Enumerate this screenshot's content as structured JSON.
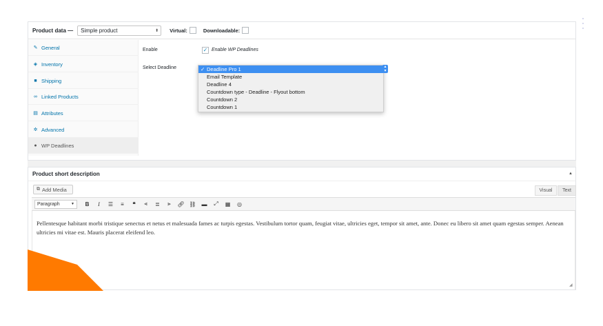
{
  "product_data": {
    "title": "Product data —",
    "type_select": "Simple product",
    "virtual_label": "Virtual:",
    "downloadable_label": "Downloadable:"
  },
  "tabs": [
    {
      "label": "General",
      "icon": "wrench-icon",
      "active": false
    },
    {
      "label": "Inventory",
      "icon": "tag-icon",
      "active": false
    },
    {
      "label": "Shipping",
      "icon": "truck-icon",
      "active": false
    },
    {
      "label": "Linked Products",
      "icon": "link-icon",
      "active": false
    },
    {
      "label": "Attributes",
      "icon": "table-icon",
      "active": false
    },
    {
      "label": "Advanced",
      "icon": "gear-icon",
      "active": false
    },
    {
      "label": "WP Deadlines",
      "icon": "clock-icon",
      "active": true
    }
  ],
  "fields": {
    "enable_label": "Enable",
    "enable_checkbox_text": "Enable WP Deadlines",
    "select_label": "Select Deadline"
  },
  "deadline_options": [
    {
      "label": "Deadline Pro 1",
      "selected": true
    },
    {
      "label": "Email Template",
      "selected": false
    },
    {
      "label": "Deadline 4",
      "selected": false
    },
    {
      "label": "Countdown type - Deadline - Flyout bottom",
      "selected": false
    },
    {
      "label": "Countdown 2",
      "selected": false
    },
    {
      "label": "Countdown 1",
      "selected": false
    }
  ],
  "short_description": {
    "title": "Product short description",
    "add_media": "Add Media",
    "visual_tab": "Visual",
    "text_tab": "Text",
    "format_select": "Paragraph",
    "content": "Pellentesque habitant morbi tristique senectus et netus et malesuada fames ac turpis egestas. Vestibulum tortor quam, feugiat vitae, ultricies eget, tempor sit amet, ante. Donec eu libero sit amet quam egestas semper. Aenean ultricies mi vitae est. Mauris placerat eleifend leo."
  },
  "colors": {
    "accent_blue": "#3f51b5",
    "accent_orange": "#ff7a00",
    "link_blue": "#0073aa",
    "selection_blue": "#3d8ff1"
  }
}
